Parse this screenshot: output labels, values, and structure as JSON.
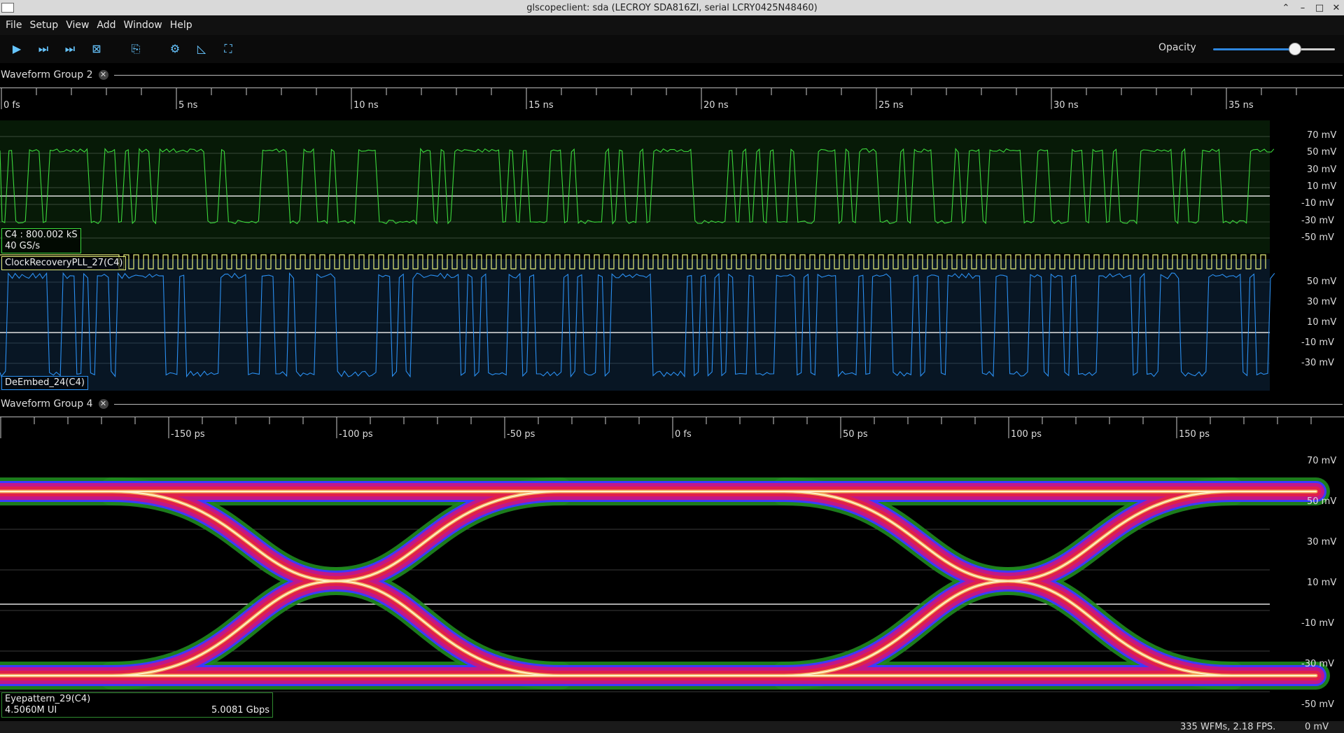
{
  "window": {
    "title": "glscopeclient: sda (LECROY SDA816ZI, serial LCRY0425N48460)"
  },
  "menu": [
    "File",
    "Setup",
    "View",
    "Add",
    "Window",
    "Help"
  ],
  "toolbar": {
    "buttons": [
      {
        "name": "start-trigger-button",
        "icon": "play-icon",
        "glyph": "▶"
      },
      {
        "name": "single-trigger-button",
        "icon": "step-icon",
        "glyph": "⏭"
      },
      {
        "name": "force-trigger-button",
        "icon": "force-icon",
        "glyph": "⏭"
      },
      {
        "name": "stop-trigger-button",
        "icon": "stop-icon",
        "glyph": "⊠"
      },
      {
        "name": "history-button",
        "icon": "history-icon",
        "glyph": "⎘"
      },
      {
        "name": "refresh-settings-button",
        "icon": "gear-icon",
        "glyph": "⚙"
      },
      {
        "name": "persistence-button",
        "icon": "persistence-icon",
        "glyph": "◺"
      },
      {
        "name": "fullscreen-button",
        "icon": "fullscreen-icon",
        "glyph": "⛶"
      }
    ],
    "opacity_label": "Opacity",
    "opacity_value": 0.68
  },
  "groups": [
    {
      "name": "Waveform Group 2",
      "time_ticks": [
        "0 fs",
        "5 ns",
        "10 ns",
        "15 ns",
        "20 ns",
        "25 ns",
        "30 ns",
        "35 ns"
      ],
      "panels": [
        {
          "id": "c4",
          "color": "#3cd83c",
          "ylabels": [
            "70 mV",
            "50 mV",
            "30 mV",
            "10 mV",
            "-10 mV",
            "-30 mV",
            "-50 mV"
          ],
          "info_line1": "C4 : 800.002 kS",
          "info_line2": "40 GS/s"
        },
        {
          "id": "deembed",
          "color": "#2a8ff0",
          "overlay_label": "ClockRecoveryPLL_27(C4)",
          "overlay_color": "#e6f07a",
          "ylabels": [
            "50 mV",
            "30 mV",
            "10 mV",
            "-10 mV",
            "-30 mV"
          ],
          "info_line1": "DeEmbed_24(C4)"
        }
      ]
    },
    {
      "name": "Waveform Group 4",
      "time_ticks": [
        "-150 ps",
        "-100 ps",
        "-50 ps",
        "0 fs",
        "50 ps",
        "100 ps",
        "150 ps"
      ],
      "panels": [
        {
          "id": "eye",
          "ylabels": [
            "70 mV",
            "50 mV",
            "30 mV",
            "10 mV",
            "-10 mV",
            "-30 mV",
            "-50 mV"
          ],
          "info_line1": "Eyepattern_29(C4)",
          "info_line2": "4.5060M UI",
          "info_rate": "5.0081 Gbps"
        }
      ]
    }
  ],
  "status": {
    "fps": "335 WFMs, 2.18 FPS.",
    "cursor": "0 mV"
  }
}
